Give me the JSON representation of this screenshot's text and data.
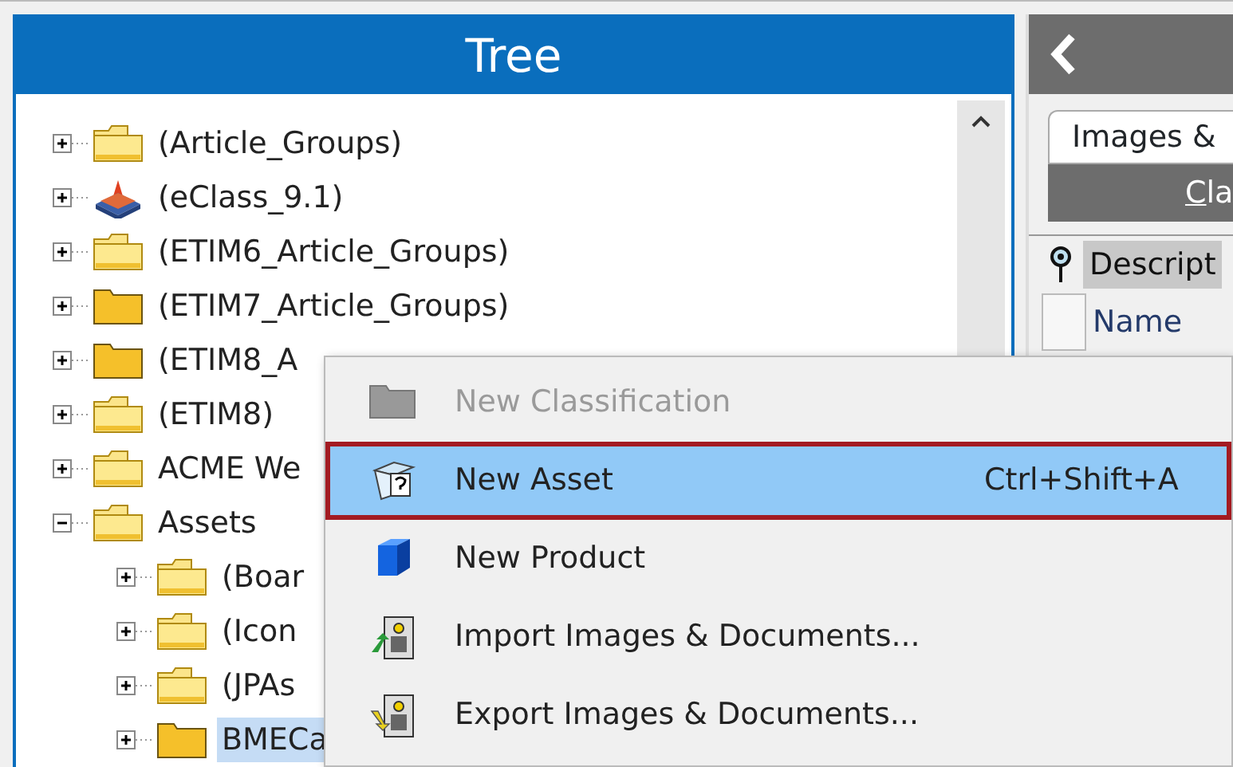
{
  "tree": {
    "title": "Tree",
    "items": [
      {
        "label": "(Article_Groups)",
        "kind": "folder",
        "expanded": false,
        "selected": false
      },
      {
        "label": "(eClass_9.1)",
        "kind": "eclass",
        "expanded": false,
        "selected": false
      },
      {
        "label": "(ETIM6_Article_Groups)",
        "kind": "folder",
        "expanded": false,
        "selected": false
      },
      {
        "label": "(ETIM7_Article_Groups)",
        "kind": "darkfolder",
        "expanded": false,
        "selected": false
      },
      {
        "label": "(ETIM8_A",
        "kind": "darkfolder",
        "expanded": false,
        "selected": false
      },
      {
        "label": "(ETIM8)",
        "kind": "folder",
        "expanded": false,
        "selected": false
      },
      {
        "label": "ACME We",
        "kind": "folder",
        "expanded": false,
        "selected": false
      },
      {
        "label": "Assets",
        "kind": "folder",
        "expanded": true,
        "selected": false,
        "children": [
          {
            "label": "(Boar",
            "kind": "folder",
            "expanded": false,
            "selected": false
          },
          {
            "label": "(Icon",
            "kind": "folder",
            "expanded": false,
            "selected": false
          },
          {
            "label": "(JPAs",
            "kind": "folder",
            "expanded": false,
            "selected": false
          },
          {
            "label": "BMECa",
            "kind": "darkfolder",
            "expanded": false,
            "selected": true
          }
        ]
      }
    ]
  },
  "details": {
    "tab": "Images &",
    "bar": "Cla",
    "rows": [
      "Descript",
      "Name"
    ]
  },
  "context_menu": [
    {
      "label": "New Classification",
      "kind": "classification",
      "disabled": true,
      "selected": false
    },
    {
      "label": "New Asset",
      "kind": "asset",
      "disabled": false,
      "selected": true,
      "shortcut": "Ctrl+Shift+A"
    },
    {
      "label": "New Product",
      "kind": "cube",
      "disabled": false,
      "selected": false
    },
    {
      "label": "Import Images & Documents...",
      "kind": "import",
      "disabled": false,
      "selected": false
    },
    {
      "label": "Export Images & Documents...",
      "kind": "export",
      "disabled": false,
      "selected": false
    }
  ]
}
